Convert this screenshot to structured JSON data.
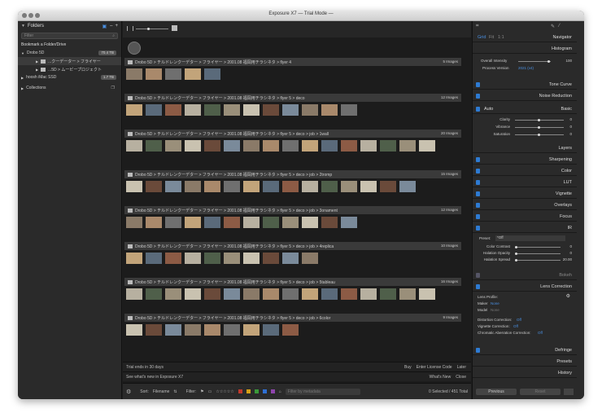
{
  "window": {
    "title": "Exposure X7 — Trial Mode —"
  },
  "left": {
    "header": "Folders",
    "search_placeholder": "Filter",
    "bookmark": "Bookmark a Folder/Drive",
    "drives": [
      {
        "label": "Drobo 5D",
        "value": "70.4 TB"
      },
      {
        "label": "...クーデーター > フライヤー",
        "value": ""
      },
      {
        "label": "...5D > ムービープロジェクト",
        "value": ""
      },
      {
        "label": "hoosh iMac SSD",
        "value": "1.7 TB"
      },
      {
        "label": "Collections",
        "value": ""
      }
    ]
  },
  "center": {
    "sections": [
      {
        "path": "Drobo 5D > チルドレンクーデター > フライヤー > 2001.08 福岡用チラシネタ > flyer 4",
        "count": "5 Images",
        "thumbs": 5
      },
      {
        "path": "Drobo 5D > チルドレンクーデター > フライヤー > 2001.08 福岡用チラシネタ > flyer 5 > deco",
        "count": "12 Images",
        "thumbs": 12
      },
      {
        "path": "Drobo 5D > チルドレンクーデター > フライヤー > 2001.08 福岡用チラシネタ > flyer 5 > deco > job > 1wall",
        "count": "20 Images",
        "thumbs": 16
      },
      {
        "path": "Drobo 5D > チルドレンクーデター > フライヤー > 2001.08 福岡用チラシネタ > flyer 5 > deco > job > 2tromp",
        "count": "15 Images",
        "thumbs": 15
      },
      {
        "path": "Drobo 5D > チルドレンクーデター > フライヤー > 2001.08 福岡用チラシネタ > flyer 5 > deco > job > 3onament",
        "count": "12 Images",
        "thumbs": 12
      },
      {
        "path": "Drobo 5D > チルドレンクーデター > フライヤー > 2001.08 福岡用チラシネタ > flyer 5 > deco > job > 4replica",
        "count": "10 Images",
        "thumbs": 10
      },
      {
        "path": "Drobo 5D > チルドレンクーデター > フライヤー > 2001.08 福岡用チラシネタ > flyer 5 > deco > job > 5tableau",
        "count": "16 Images",
        "thumbs": 16
      },
      {
        "path": "Drobo 5D > チルドレンクーデター > フライヤー > 2001.08 福岡用チラシネタ > flyer 5 > deco > job > 6color",
        "count": "9 Images",
        "thumbs": 9
      }
    ],
    "trial": {
      "text": "Trial ends in 30 days",
      "buy": "Buy",
      "license": "Enter License Code",
      "later": "Later"
    },
    "whatsnew": {
      "text": "See what's new in Exposure X7",
      "link": "What's New",
      "close": "Close"
    },
    "toolbar": {
      "sort_label": "Sort:",
      "sort_value": "Filename",
      "filter_label": "Filter:",
      "metadata_placeholder": "Filter by metadata",
      "status": "0 Selected / 451 Total"
    }
  },
  "right": {
    "view_tabs": [
      "Grid",
      "Fit",
      "1:1"
    ],
    "panels": {
      "navigator": "Navigator",
      "histogram": "Histogram",
      "tone_curve": "Tone Curve",
      "noise": "Noise Reduction",
      "basic": "Basic",
      "auto": "Auto",
      "layers": "Layers",
      "sharpening": "Sharpening",
      "color": "Color",
      "lut": "LUT",
      "vignette": "Vignette",
      "overlays": "Overlays",
      "focus": "Focus",
      "ir": "IR",
      "bokeh": "Bokeh",
      "lens": "Lens Correction",
      "defringe": "Defringe",
      "presets": "Presets",
      "history": "History"
    },
    "overall": {
      "label": "Overall Intensity",
      "value": "100",
      "process_label": "Process Version",
      "process_value": "2021 (v4)"
    },
    "basic_sliders": [
      {
        "label": "Clarity",
        "value": "0"
      },
      {
        "label": "Vibrance",
        "value": "0"
      },
      {
        "label": "Saturation",
        "value": "0"
      }
    ],
    "ir": {
      "preset_label": "Preset:",
      "preset_value": "*Off",
      "rows": [
        {
          "label": "Color Contrast",
          "value": "0"
        },
        {
          "label": "Halation Opacity",
          "value": "0"
        },
        {
          "label": "Halation Spread",
          "value": "20.00"
        }
      ]
    },
    "lens": {
      "profile": "Lens Profile:",
      "maker": "Maker",
      "maker_value": "None",
      "model": "Model",
      "model_value": "None",
      "distortion": "Distortion Correction:",
      "distortion_value": "Off",
      "vignette": "Vignette Correction:",
      "vignette_value": "Off",
      "chromatic": "Chromatic Aberration Correction:",
      "chromatic_value": "Off"
    },
    "footer": {
      "previous": "Previous",
      "reset": "Reset"
    }
  },
  "colors": {
    "accent": "#2e7bd3",
    "swatches": [
      "#c0392b",
      "#d4a017",
      "#3a9a3a",
      "#2e6fd3",
      "#8e44ad"
    ]
  }
}
